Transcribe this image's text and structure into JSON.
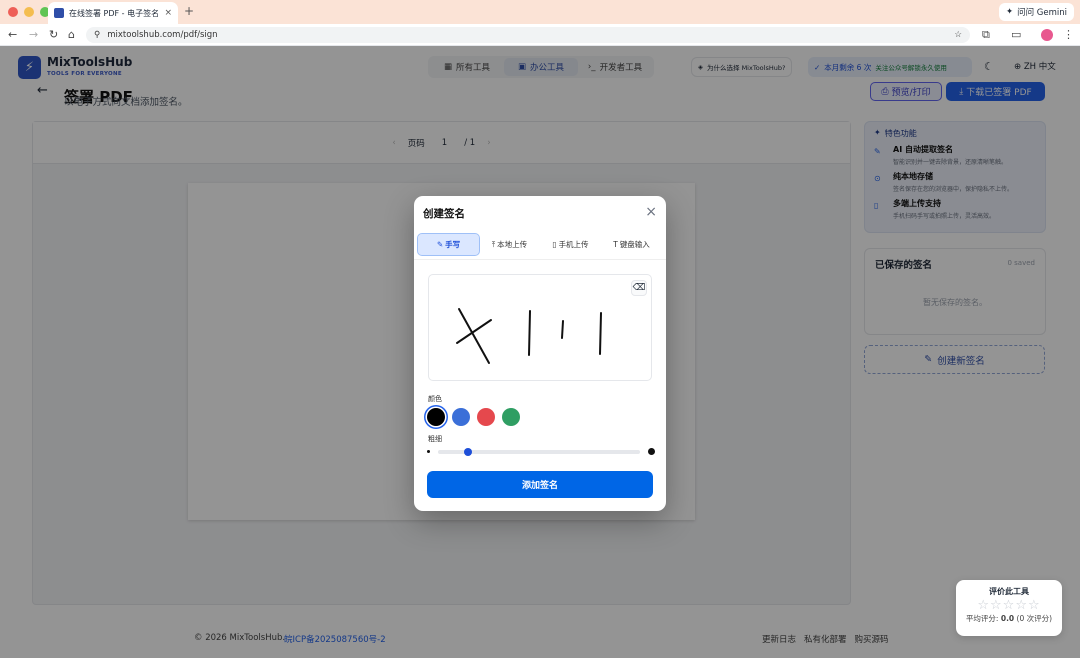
{
  "browser": {
    "tab_title": "在线签署 PDF - 电子签名",
    "close_glyph": "×",
    "new_tab_glyph": "+",
    "url": "mixtoolshub.com/pdf/sign",
    "gemini": "问问 Gemini"
  },
  "header": {
    "logo_name": "MixToolsHub",
    "logo_sub": "TOOLS FOR EVERYONE",
    "nav": [
      {
        "label": "所有工具",
        "icon": "grid-icon"
      },
      {
        "label": "办公工具",
        "icon": "briefcase-icon"
      },
      {
        "label": "开发者工具",
        "icon": "code-icon"
      }
    ],
    "why_label": "为什么选择 MixToolsHub?",
    "quota_label": "本月剩余 6 次",
    "quota_note": "关注公众号解锁永久使用",
    "lang": "ZH 中文"
  },
  "page": {
    "title": "签署 PDF",
    "subtitle": "以电子方式向文档添加签名。",
    "preview_label": "预览/打印",
    "download_label": "下载已签署 PDF"
  },
  "viewer": {
    "page_label": "页码",
    "page_current": "1",
    "page_total": "/ 1"
  },
  "features": {
    "heading": "特色功能",
    "items": [
      {
        "title": "AI 自动提取签名",
        "desc": "智能识别并一键去除背景，还原清晰笔触。"
      },
      {
        "title": "纯本地存储",
        "desc": "签名保存在您的浏览器中，保护隐私不上传。"
      },
      {
        "title": "多端上传支持",
        "desc": "手机扫码手写或拍照上传，灵活高效。"
      }
    ]
  },
  "saved": {
    "title": "已保存的签名",
    "count": "0 saved",
    "empty": "暂无保存的签名。",
    "create_label": "创建新签名"
  },
  "rating": {
    "title": "评价此工具",
    "stars": "☆☆☆☆☆",
    "avg_prefix": "平均评分:",
    "avg_value": "0.0",
    "avg_suffix": "(0 次评分)"
  },
  "footer": {
    "copyright": "© 2026 MixToolsHub.",
    "icp": "皖ICP备2025087560号-2",
    "links": [
      "更新日志",
      "私有化部署",
      "购买源码"
    ]
  },
  "modal": {
    "title": "创建签名",
    "tabs": [
      {
        "label": "手写",
        "icon": "pen-icon",
        "active": true
      },
      {
        "label": "本地上传",
        "icon": "upload-icon",
        "active": false
      },
      {
        "label": "手机上传",
        "icon": "phone-icon",
        "active": false
      },
      {
        "label": "键盘输入",
        "icon": "type-icon",
        "active": false
      }
    ],
    "color_label": "颜色",
    "thickness_label": "粗细",
    "thickness_value": 0.15,
    "colors": [
      "#000000",
      "#3b6fd8",
      "#e5484d",
      "#2f9e63"
    ],
    "selected_color": "#000000",
    "add_label": "添加签名"
  }
}
